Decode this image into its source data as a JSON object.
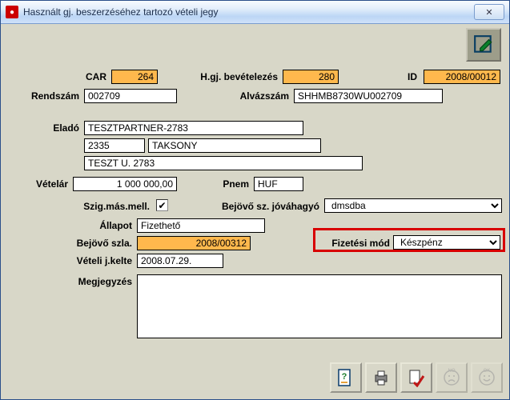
{
  "window": {
    "title": "Használt gj. beszerzéséhez tartozó vételi jegy"
  },
  "labels": {
    "car": "CAR",
    "bevetelezes": "H.gj. bevételezés",
    "id": "ID",
    "rendszam": "Rendszám",
    "alvazszam": "Alvázszám",
    "elado": "Eladó",
    "vetelar": "Vételár",
    "pnem": "Pnem",
    "szig": "Szig.más.mell.",
    "jovahagyo": "Bejövő sz. jóváhagyó",
    "allapot": "Állapot",
    "fiz_mod": "Fizetési mód",
    "bejovo_szla": "Bejövő szla.",
    "veteli_kelte": "Vételi j.kelte",
    "megjegyzes": "Megjegyzés"
  },
  "fields": {
    "car": "264",
    "bevetelezes": "280",
    "id": "2008/00012",
    "rendszam": "002709",
    "alvazszam": "SHHMB8730WU002709",
    "elado_nev": "TESZTPARTNER-2783",
    "elado_irsz": "2335",
    "elado_varos": "TAKSONY",
    "elado_utca": "TESZT U. 2783",
    "vetelar": "1 000 000,00",
    "pnem": "HUF",
    "szig_checked": "✔",
    "jovahagyo": "dmsdba",
    "allapot": "Fizethető",
    "fiz_mod": "Készpénz",
    "bejovo_szla": "2008/00312",
    "veteli_kelte": "2008.07.29.",
    "megjegyzes": ""
  },
  "buttons": {
    "close": "✕",
    "no": "NO",
    "ok": "OK"
  }
}
